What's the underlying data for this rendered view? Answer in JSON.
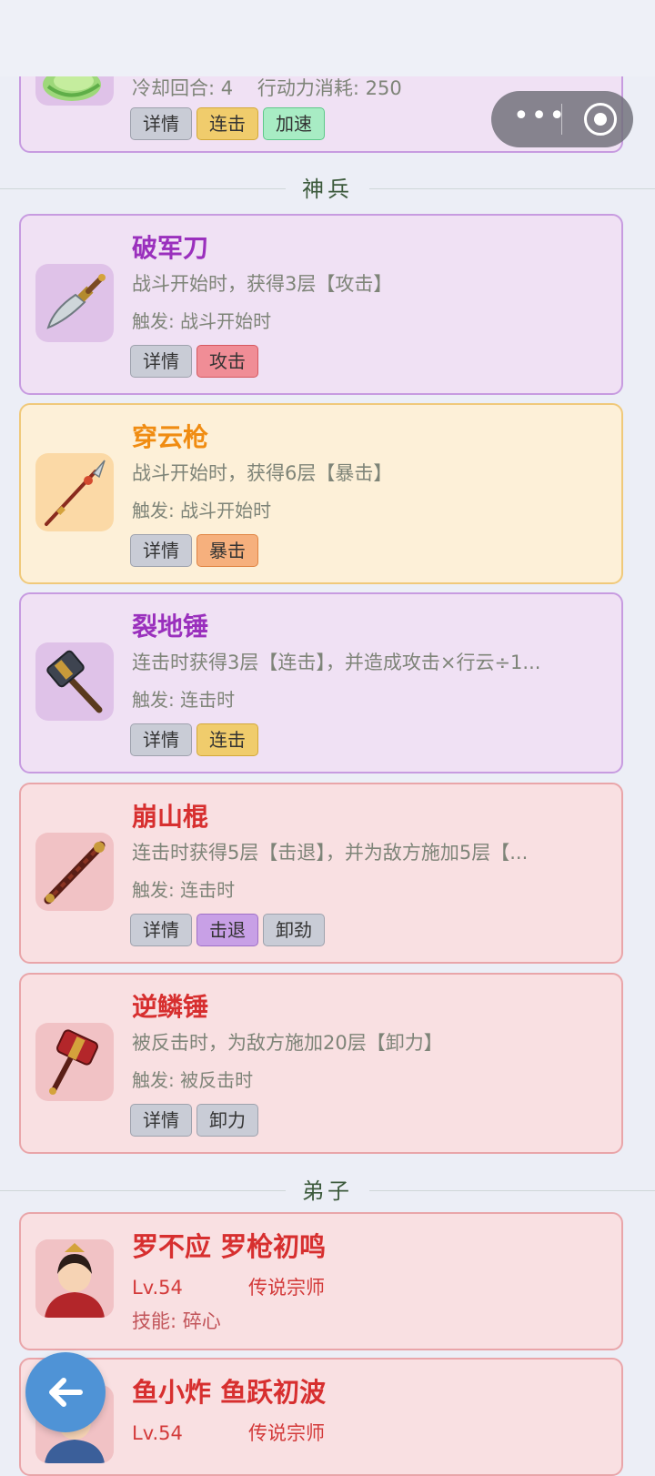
{
  "top_card": {
    "cooldown": "冷却回合: 4",
    "cost": "行动力消耗: 250",
    "tags": [
      "详情",
      "连击",
      "加速"
    ]
  },
  "sections": {
    "weapons": "神兵",
    "disciples": "弟子"
  },
  "weapons": [
    {
      "name": "破军刀",
      "desc": "战斗开始时，获得3层【攻击】",
      "trigger": "触发: 战斗开始时",
      "tags": [
        "详情",
        "攻击"
      ],
      "theme": "purple",
      "icon": "broadsword-icon"
    },
    {
      "name": "穿云枪",
      "desc": "战斗开始时，获得6层【暴击】",
      "trigger": "触发: 战斗开始时",
      "tags": [
        "详情",
        "暴击"
      ],
      "theme": "gold",
      "icon": "spear-icon"
    },
    {
      "name": "裂地锤",
      "desc": "连击时获得3层【连击】，并造成攻击×行云÷1...",
      "trigger": "触发: 连击时",
      "tags": [
        "详情",
        "连击"
      ],
      "theme": "purple",
      "icon": "hammer-icon"
    },
    {
      "name": "崩山棍",
      "desc": "连击时获得5层【击退】，并为敌方施加5层【...",
      "trigger": "触发: 连击时",
      "tags": [
        "详情",
        "击退",
        "卸劲"
      ],
      "theme": "red",
      "icon": "staff-icon"
    },
    {
      "name": "逆鳞锤",
      "desc": "被反击时，为敌方施加20层【卸力】",
      "trigger": "触发: 被反击时",
      "tags": [
        "详情",
        "卸力"
      ],
      "theme": "red",
      "icon": "war-hammer-icon"
    }
  ],
  "disciples": [
    {
      "name": "罗不应 罗枪初鸣",
      "level": "Lv.54",
      "rank": "传说宗师",
      "skill": "技能: 碎心",
      "icon": "disciple-avatar-icon"
    },
    {
      "name": "鱼小炸 鱼跃初波",
      "level": "Lv.54",
      "rank": "传说宗师",
      "icon": "disciple-avatar-icon"
    }
  ],
  "colors": {
    "purple_card": "#f0e1f4",
    "gold_card": "#fdf0d8",
    "red_card": "#f9e0e2",
    "back_button": "#4f93d6"
  }
}
